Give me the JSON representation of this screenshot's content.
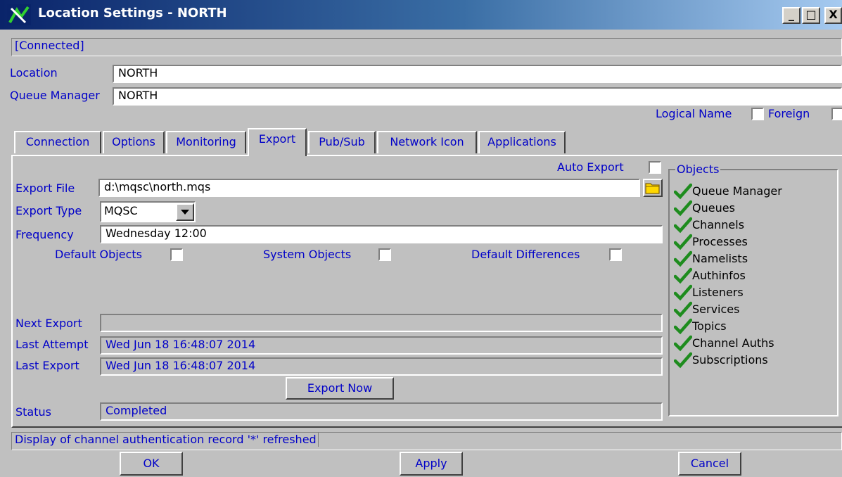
{
  "window": {
    "title": "Location Settings - NORTH",
    "controls": [
      "_",
      "□",
      "X"
    ]
  },
  "connection_status": "[Connected]",
  "location": {
    "label": "Location",
    "value": "NORTH"
  },
  "queue_manager": {
    "label": "Queue Manager",
    "value": "NORTH"
  },
  "options_row": {
    "logical_name_label": "Logical Name",
    "foreign_label": "Foreign"
  },
  "tabs": [
    {
      "label": "Connection"
    },
    {
      "label": "Options"
    },
    {
      "label": "Monitoring"
    },
    {
      "label": "Export"
    },
    {
      "label": "Pub/Sub"
    },
    {
      "label": "Network Icon"
    },
    {
      "label": "Applications"
    }
  ],
  "export": {
    "auto_export_label": "Auto Export",
    "export_file_label": "Export File",
    "export_file_value": "d:\\mqsc\\north.mqs",
    "export_type_label": "Export Type",
    "export_type_value": "MQSC",
    "frequency_label": "Frequency",
    "frequency_value": "Wednesday 12:00",
    "default_objects_label": "Default Objects",
    "system_objects_label": "System Objects",
    "default_differences_label": "Default Differences",
    "next_export_label": "Next Export",
    "next_export_value": "",
    "last_attempt_label": "Last Attempt",
    "last_attempt_value": "Wed Jun 18 16:48:07 2014",
    "last_export_label": "Last Export",
    "last_export_value": "Wed Jun 18 16:48:07 2014",
    "export_now_label": "Export Now",
    "status_label": "Status",
    "status_value": "Completed"
  },
  "objects": {
    "legend": "Objects",
    "items": [
      {
        "label": "Queue Manager"
      },
      {
        "label": "Queues"
      },
      {
        "label": "Channels"
      },
      {
        "label": "Processes"
      },
      {
        "label": "Namelists"
      },
      {
        "label": "Authinfos"
      },
      {
        "label": "Listeners"
      },
      {
        "label": "Services"
      },
      {
        "label": "Topics"
      },
      {
        "label": "Channel Auths"
      },
      {
        "label": "Subscriptions"
      }
    ],
    "check_color": "#1e8c1e"
  },
  "status_message": "Display of channel authentication record '*' refreshed",
  "buttons": {
    "ok": "OK",
    "apply": "Apply",
    "cancel": "Cancel"
  }
}
